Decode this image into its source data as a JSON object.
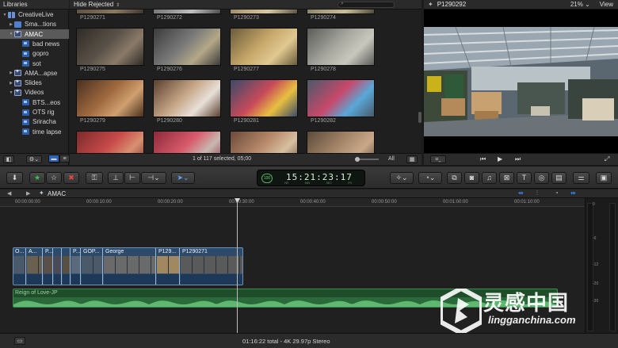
{
  "libraries": {
    "header": "Libraries",
    "items": [
      {
        "label": "CreativeLive",
        "type": "library"
      },
      {
        "label": "Sma...tions",
        "type": "folder"
      },
      {
        "label": "AMAC",
        "type": "event",
        "selected": true
      },
      {
        "label": "bad news",
        "type": "keyword"
      },
      {
        "label": "gopro",
        "type": "keyword"
      },
      {
        "label": "sot",
        "type": "keyword"
      },
      {
        "label": "AMA...apse",
        "type": "event"
      },
      {
        "label": "Slides",
        "type": "event"
      },
      {
        "label": "Videos",
        "type": "event"
      },
      {
        "label": "BTS...eos",
        "type": "keyword"
      },
      {
        "label": "OTS rig",
        "type": "keyword"
      },
      {
        "label": "Sriracha",
        "type": "keyword"
      },
      {
        "label": "time lapse",
        "type": "keyword"
      }
    ]
  },
  "browser": {
    "filter": "Hide Rejected",
    "clips": [
      {
        "name": "P1290271"
      },
      {
        "name": "P1290272"
      },
      {
        "name": "P1290273"
      },
      {
        "name": "P1290274"
      },
      {
        "name": "P1290275"
      },
      {
        "name": "P1290276"
      },
      {
        "name": "P1290277"
      },
      {
        "name": "P1290278"
      },
      {
        "name": "P1290279"
      },
      {
        "name": "P1290280"
      },
      {
        "name": "P1290281"
      },
      {
        "name": "P1290282"
      },
      {
        "name": ""
      },
      {
        "name": ""
      },
      {
        "name": ""
      },
      {
        "name": ""
      }
    ],
    "status": "1 of 117 selected, 05;00",
    "filter_all": "All"
  },
  "viewer": {
    "title": "P1290292",
    "zoom": "21%",
    "view_label": "View"
  },
  "toolbar": {
    "timecode": "15:21:23:17",
    "timecode_pct": "100",
    "timecode_units": [
      "HR",
      "MIN",
      "SEC",
      "FR"
    ]
  },
  "timeline": {
    "project": "AMAC",
    "ruler": [
      "00:00:00:00",
      "00:00:10:00",
      "00:00:20:00",
      "00:00:30:00",
      "00:00:40:00",
      "00:00:50:00",
      "00:01:00:00",
      "00:01:10:00"
    ],
    "storyline_clips": [
      {
        "name": "O..."
      },
      {
        "name": "A..."
      },
      {
        "name": "P..."
      },
      {
        "name": ""
      },
      {
        "name": ""
      },
      {
        "name": "P..."
      },
      {
        "name": "GOP..."
      },
      {
        "name": "George"
      },
      {
        "name": "P129..."
      },
      {
        "name": "P1290271"
      }
    ],
    "audio_clip": "Reign of Love-JP",
    "meter_labels": [
      "0",
      "-6",
      "-12",
      "-20",
      "-30"
    ]
  },
  "status_bar": {
    "text": "01:16:22 total - 4K 29.97p Stereo"
  },
  "watermark": {
    "cn": "灵感中国",
    "en": "lingganchina.com"
  },
  "colors": {
    "selection": "#5a5a5a",
    "storyline": "#2d4a6a",
    "audio": "#1f4d2a",
    "accent_blue": "#2f7fe0"
  }
}
